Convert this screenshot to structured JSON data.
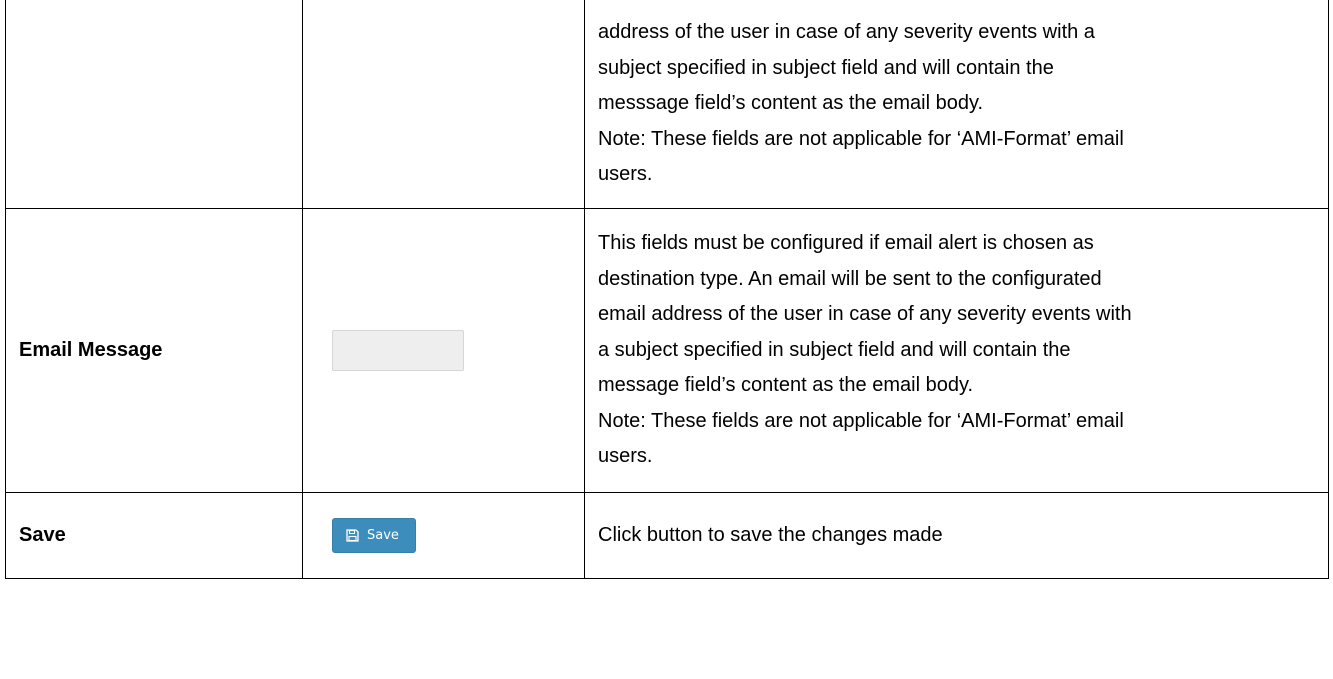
{
  "rows": [
    {
      "label": "",
      "description_lines": [
        "address of the user in case of any severity events with a",
        "subject specified in subject field and will contain the",
        "messsage field’s content as the email body.",
        "Note: These fields are not applicable for ‘AMI-Format’ email",
        "users."
      ]
    },
    {
      "label": "Email Message",
      "input_value": "",
      "description_lines": [
        "This fields must be configured if email alert is chosen as",
        "destination type. An email will be sent to the configurated",
        "email address of the user in case of any severity events with",
        "a subject specified in subject field and will contain the",
        "message field’s content as the email body.",
        "Note: These fields are not applicable for ‘AMI-Format’ email",
        "users."
      ]
    },
    {
      "label": "Save",
      "button_label": "Save",
      "button_icon": "floppy-disk-icon",
      "description_lines": [
        "Click button to save the changes made"
      ]
    }
  ],
  "colors": {
    "button_bg": "#3c8dbc",
    "input_bg": "#eeeeee",
    "border": "#000000"
  }
}
